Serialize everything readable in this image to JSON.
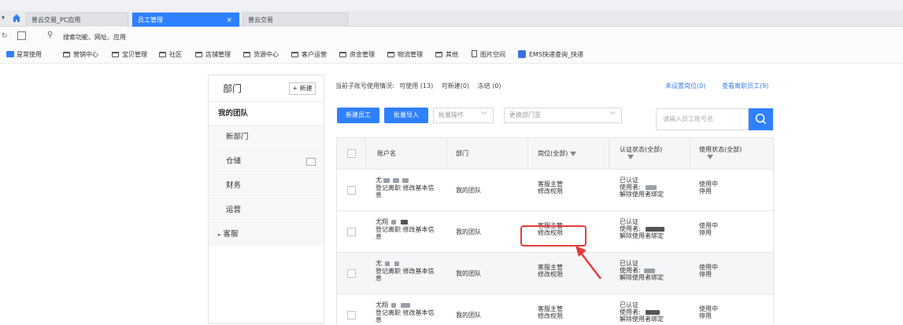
{
  "tabs": [
    {
      "label": "普云交易_PC应用"
    },
    {
      "label": "员工管理",
      "close": "×"
    },
    {
      "label": "普云交易"
    }
  ],
  "urlbar": {
    "search_text": "搜索功能、网址、应用"
  },
  "bookmarks": [
    {
      "label": "是常使用"
    },
    {
      "label": "营销中心"
    },
    {
      "label": "宝贝管理"
    },
    {
      "label": "社区"
    },
    {
      "label": "店铺管理"
    },
    {
      "label": "货源中心"
    },
    {
      "label": "客户运营"
    },
    {
      "label": "资金管理"
    },
    {
      "label": "物流管理"
    },
    {
      "label": "其他"
    },
    {
      "label": "图片空间"
    },
    {
      "label": "EMS快递查询_快递"
    }
  ],
  "dept_panel": {
    "title": "部门",
    "new_button": "+ 新建",
    "items": [
      "我的团队",
      "新部门",
      "仓储",
      "财务",
      "运营",
      "客服"
    ]
  },
  "summary": {
    "prefix": "当前子账号使用情况:",
    "available": "可使用 (13)",
    "creatable": "可新建(0)",
    "frozen": "冻结 (0)",
    "link_unset": "未设置岗位(0)",
    "link_resigned": "查看离职员工(9)"
  },
  "toolbar": {
    "new_employee": "新建员工",
    "batch_import": "批量导入",
    "batch_ops": "批量操作",
    "change_dept": "更换部门至",
    "search_placeholder": "请输入员工账号名"
  },
  "table": {
    "headers": [
      "账户名",
      "部门",
      "岗位(全部)",
      "认证状态(全部)",
      "使用状态(全部)"
    ],
    "rows": [
      {
        "account": "尤",
        "actions": "登记离职 修改基本信息",
        "dept": "我的团队",
        "role": "客服主管",
        "role_link": "修改权限",
        "auth": "已认证",
        "user": "使用者:",
        "unbind": "解除使用者绑定",
        "status": "使用中",
        "status_link": "停用"
      },
      {
        "account": "尤翔",
        "actions": "登记离职 修改基本信息",
        "dept": "我的团队",
        "role": "客服主管",
        "role_link": "修改权限",
        "auth": "已认证",
        "user": "使用者:",
        "unbind": "解除使用者绑定",
        "status": "使用中",
        "status_link": "停用"
      },
      {
        "account": "尤",
        "actions": "登记离职 修改基本信息",
        "dept": "我的团队",
        "role": "客服主管",
        "role_link": "修改权限",
        "auth": "已认证",
        "user": "使用者:",
        "unbind": "解除使用者绑定",
        "status": "使用中",
        "status_link": "停用"
      },
      {
        "account": "尤翔",
        "actions": "登记离职 修改基本信息",
        "dept": "我的团队",
        "role": "客服主管",
        "role_link": "修改权限",
        "auth": "已认证",
        "user": "使用者:",
        "unbind": "解除使用者绑定",
        "status": "使用中",
        "status_link": "停用"
      }
    ]
  },
  "colors": {
    "accent": "#2f80ff",
    "link": "#3b7ae6",
    "annotation": "#e53b3b"
  }
}
